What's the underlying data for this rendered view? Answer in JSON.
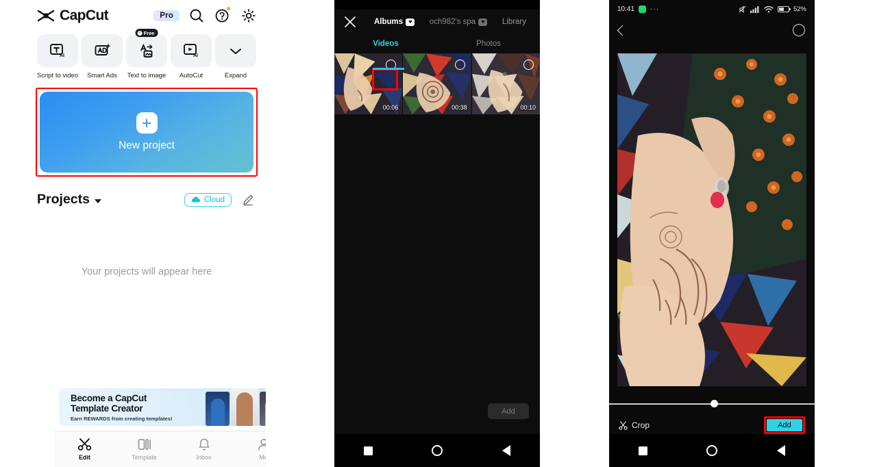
{
  "panel1": {
    "app_name": "CapCut",
    "pro_badge": "Pro",
    "icons": {
      "search": "search-icon",
      "help": "help-icon",
      "settings": "gear-icon"
    },
    "tools": [
      {
        "label": "Script to video",
        "icon": "script-to-video-icon",
        "badge": ""
      },
      {
        "label": "Smart Ads",
        "icon": "smart-ads-icon",
        "badge": ""
      },
      {
        "label": "Text to image",
        "icon": "text-to-image-icon",
        "badge": "Free"
      },
      {
        "label": "AutoCut",
        "icon": "autocut-icon",
        "badge": ""
      },
      {
        "label": "Expand",
        "icon": "chevron-down-icon",
        "badge": ""
      }
    ],
    "new_project": {
      "label": "New project",
      "plus": "+"
    },
    "projects": {
      "title": "Projects",
      "cloud_label": "Cloud",
      "empty_text": "Your projects will appear here"
    },
    "promo": {
      "line1": "Become a CapCut",
      "line2": "Template Creator",
      "subtitle": "Earn REWARDS from creating templates!",
      "close": "✕"
    },
    "tabs": [
      {
        "label": "Edit",
        "icon": "scissors-icon",
        "active": true
      },
      {
        "label": "Template",
        "icon": "template-icon",
        "active": false
      },
      {
        "label": "Inbox",
        "icon": "bell-icon",
        "active": false
      },
      {
        "label": "Me",
        "icon": "person-icon",
        "active": false
      }
    ]
  },
  "panel2": {
    "close": "✕",
    "albums_label": "Albums",
    "account_label": "och982's spa",
    "library_label": "Library",
    "subtabs": [
      {
        "label": "Videos",
        "active": true
      },
      {
        "label": "Photos",
        "active": false
      }
    ],
    "thumbnails": [
      {
        "duration": "00:06",
        "selected": false
      },
      {
        "duration": "00:38",
        "selected": false
      },
      {
        "duration": "00:10",
        "selected": false
      }
    ],
    "add_label": "Add",
    "nav": {
      "recent": "square-icon",
      "home": "circle-icon",
      "back": "triangle-back-icon"
    }
  },
  "panel3": {
    "statusbar": {
      "time": "10:41",
      "app_icon": "whatsapp-icon",
      "dots": "···",
      "battery_pct": "52%"
    },
    "back": "chevron-left-icon",
    "select": "select-circle-icon",
    "crop_label": "Crop",
    "add_label": "Add",
    "nav": {
      "recent": "square-icon",
      "home": "circle-icon",
      "back": "triangle-back-icon"
    }
  },
  "colors": {
    "accent_cyan": "#2fd2e8",
    "highlight_red": "#ff0000",
    "brand_blue": "#2d94f0",
    "whatsapp_green": "#25d366"
  }
}
